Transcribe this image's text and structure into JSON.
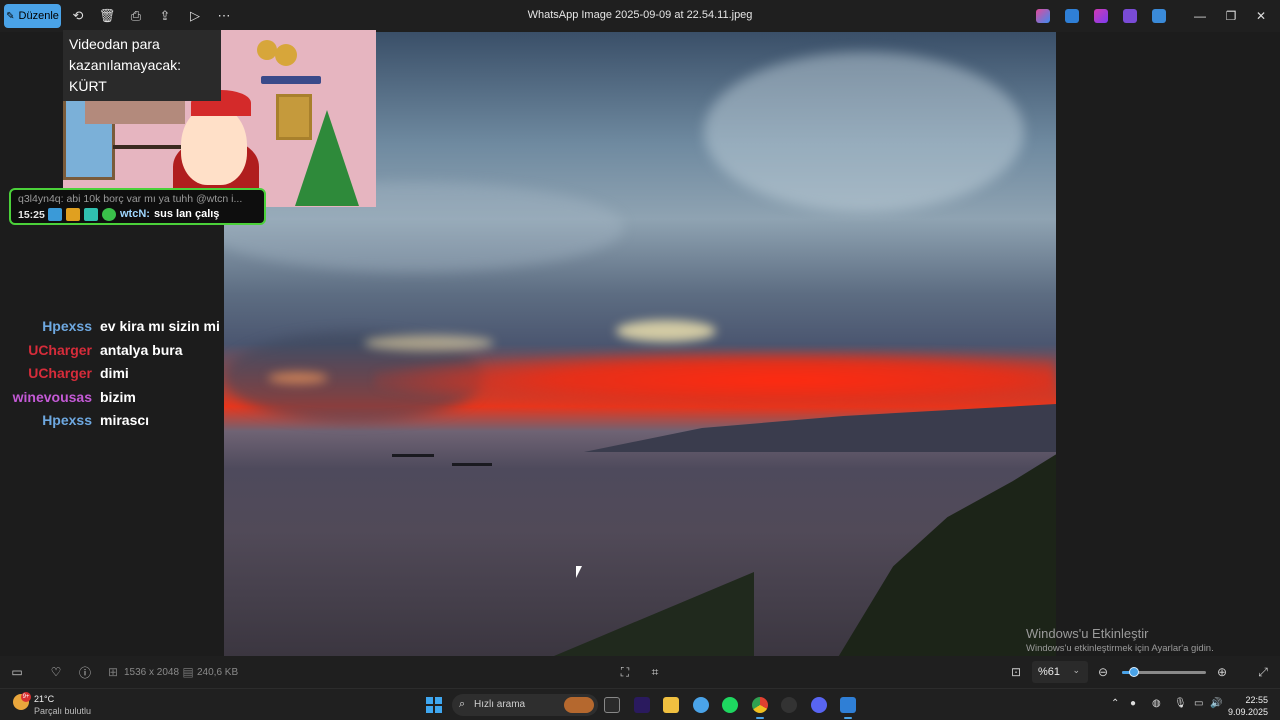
{
  "app": {
    "title": "WhatsApp Image 2025-09-09 at 22.54.11.jpeg",
    "edit_label": "Düzenle"
  },
  "icons": {
    "toolbar": [
      "rotate-icon",
      "delete-icon",
      "print-icon",
      "share-icon",
      "slideshow-icon",
      "more-icon"
    ],
    "window": [
      "minimize-icon",
      "maximize-icon",
      "close-icon"
    ]
  },
  "overlay": {
    "caption": "Videodan para kazanılamayacak: KÜRT"
  },
  "pinned_chat": {
    "reply": "q3l4yn4q: abi 10k borç var mı ya tuhh @wtcn i...",
    "time": "15:25",
    "user": "wtcN:",
    "message": "sus lan çalış"
  },
  "chat": [
    {
      "user": "Hpexss",
      "color": "#6ea8e0",
      "message": "ev kira mı sizin mi"
    },
    {
      "user": "UCharger",
      "color": "#d62c3a",
      "message": "antalya bura"
    },
    {
      "user": "UCharger",
      "color": "#d62c3a",
      "message": "dimi"
    },
    {
      "user": "winevousas",
      "color": "#c45ad6",
      "message": "bizim"
    },
    {
      "user": "Hpexss",
      "color": "#6ea8e0",
      "message": "mirascı"
    }
  ],
  "watermark": {
    "line1": "Windows'u Etkinleştir",
    "line2": "Windows'u etkinleştirmek için Ayarlar'a gidin."
  },
  "image_info": {
    "dimensions": "1536 x 2048",
    "size": "240,6 KB"
  },
  "zoom": {
    "label": "%61",
    "value": 0.1
  },
  "taskbar": {
    "temperature": "21°C",
    "condition": "Parçalı bulutlu",
    "weather_badge": "9+",
    "search_placeholder": "Hızlı arama",
    "time": "22:55",
    "date": "9.09.2025"
  },
  "colors": {
    "accent": "#4aa3e8",
    "chat_border": "#4bd13a"
  }
}
